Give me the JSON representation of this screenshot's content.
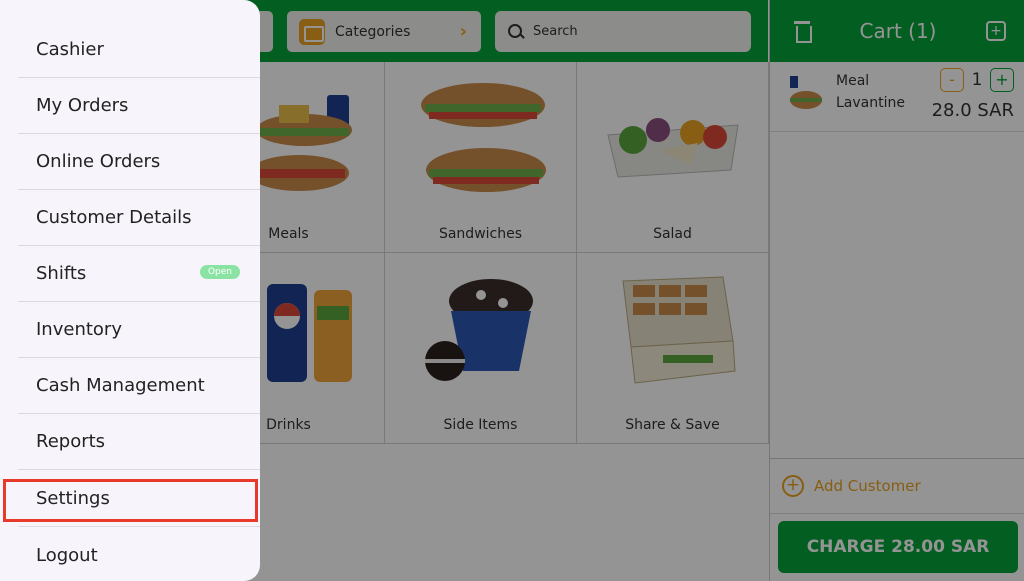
{
  "top_bar": {
    "categories_label": "Categories",
    "search_placeholder": "Search"
  },
  "products": [
    {
      "name": "Meals"
    },
    {
      "name": "Sandwiches"
    },
    {
      "name": "Salad"
    },
    {
      "name": "Drinks"
    },
    {
      "name": "Side Items"
    },
    {
      "name": "Share & Save"
    }
  ],
  "cart": {
    "title": "Cart (1)",
    "item": {
      "name_line1": "Meal",
      "name_line2": "Lavantine",
      "quantity": "1",
      "price": "28.0 SAR"
    },
    "add_customer": "Add Customer",
    "charge_label": "CHARGE 28.00 SAR"
  },
  "menu": {
    "items": [
      {
        "label": "Cashier"
      },
      {
        "label": "My Orders"
      },
      {
        "label": "Online Orders"
      },
      {
        "label": "Customer Details"
      },
      {
        "label": "Shifts",
        "badge": "Open"
      },
      {
        "label": "Inventory"
      },
      {
        "label": "Cash Management"
      },
      {
        "label": "Reports"
      },
      {
        "label": "Settings"
      },
      {
        "label": "Logout"
      }
    ]
  },
  "colors": {
    "brand_green": "#06a33a",
    "accent_orange": "#e8a321",
    "highlight_red": "#e83a2a",
    "badge_green": "#8be3a3"
  }
}
